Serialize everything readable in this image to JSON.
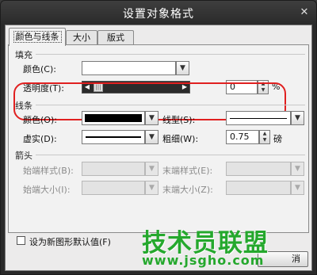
{
  "window": {
    "title": "设置对象格式",
    "close_glyph": "✕"
  },
  "tabs": [
    {
      "label": "颜色与线条",
      "active": true
    },
    {
      "label": "大小",
      "active": false
    },
    {
      "label": "版式",
      "active": false
    }
  ],
  "fill": {
    "section_title": "填充",
    "color_label": "颜色(C):",
    "color_value": "#ffffff",
    "transparency_label": "透明度(T):",
    "transparency_value": "0",
    "transparency_unit": "%",
    "transparency_fraction": 0.0
  },
  "line": {
    "section_title": "线条",
    "color_label": "颜色(O):",
    "color_value": "#000000",
    "style_label": "线型(S):",
    "dash_label": "虚实(D):",
    "weight_label": "粗细(W):",
    "weight_value": "0.75",
    "weight_unit": "磅"
  },
  "arrows": {
    "section_title": "箭头",
    "begin_style_label": "始端样式(B):",
    "end_style_label": "末端样式(E):",
    "begin_size_label": "始端大小(I):",
    "end_size_label": "末端大小(Z):"
  },
  "default_checkbox": {
    "label": "设为新图形默认值(F)",
    "checked": false
  },
  "buttons": {
    "cancel_partial": "消"
  },
  "watermark": {
    "text": "技术员联盟",
    "url": "www.jsgho.com"
  },
  "colors": {
    "highlight": "#e02020",
    "watermark": "#25a82d"
  }
}
